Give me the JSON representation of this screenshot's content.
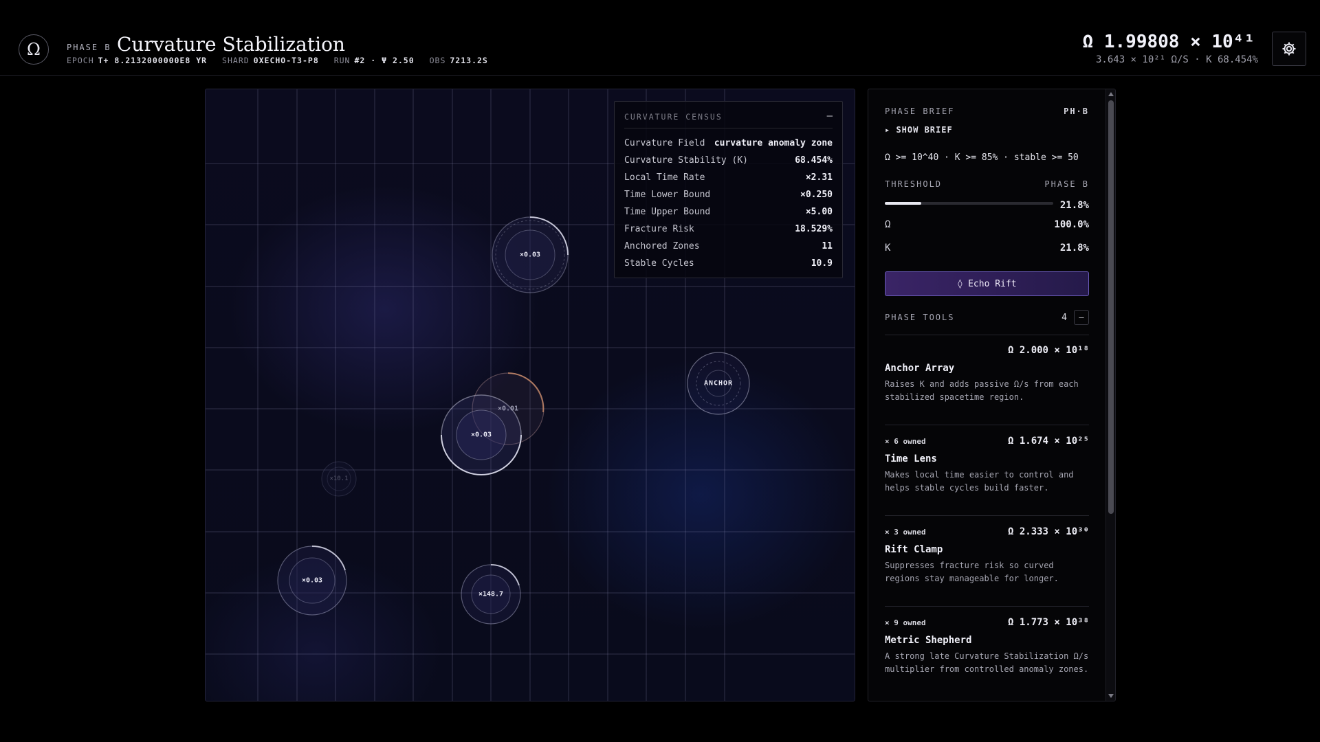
{
  "header": {
    "logo_glyph": "Ω",
    "phase_label": "PHASE B",
    "title": "Curvature Stabilization",
    "epoch_label": "EPOCH",
    "epoch_value": "T+ 8.2132000000E8 YR",
    "shard_label": "SHARD",
    "shard_value": "0XECHO-T3-P8",
    "run_label": "RUN",
    "run_value": "#2 · Ψ 2.50",
    "obs_label": "OBS",
    "obs_value": "7213.2S",
    "omega_total": "Ω 1.99808 × 10⁴¹",
    "omega_rate": "3.643 × 10²¹ Ω/S · K 68.454%",
    "settings_icon": "gear-icon"
  },
  "map": {
    "nodes": [
      {
        "label": "×0.03",
        "bright": true
      },
      {
        "label": "ANCHOR",
        "bright": true
      },
      {
        "label": "×0.01",
        "bright": false
      },
      {
        "label": "×0.03",
        "bright": true
      },
      {
        "label": "×10.1",
        "bright": false
      },
      {
        "label": "×0.03",
        "bright": true
      },
      {
        "label": "×148.7",
        "bright": true
      }
    ]
  },
  "census": {
    "title": "CURVATURE CENSUS",
    "collapse": "–",
    "rows": [
      {
        "k": "Curvature Field",
        "v": "curvature anomaly zone"
      },
      {
        "k": "Curvature Stability (K)",
        "v": "68.454%"
      },
      {
        "k": "Local Time Rate",
        "v": "×2.31"
      },
      {
        "k": "Time Lower Bound",
        "v": "×0.250"
      },
      {
        "k": "Time Upper Bound",
        "v": "×5.00"
      },
      {
        "k": "Fracture Risk",
        "v": "18.529%"
      },
      {
        "k": "Anchored Zones",
        "v": "11"
      },
      {
        "k": "Stable Cycles",
        "v": "10.9"
      }
    ]
  },
  "side": {
    "brief_label": "PHASE BRIEF",
    "brief_tag": "PH·B",
    "show_brief": "▸ SHOW BRIEF",
    "goal": "Ω >= 10^40 · K >= 85% · stable >= 50",
    "threshold_label": "THRESHOLD",
    "threshold_phase": "PHASE B",
    "threshold_pct": "21.8%",
    "threshold_fraction": 0.218,
    "omega_label": "Ω",
    "omega_pct": "100.0%",
    "k_label": "K",
    "k_pct": "21.8%",
    "echo_button": "◊ Echo Rift",
    "tools_label": "PHASE TOOLS",
    "tools_count": "4",
    "tools_toggle": "–",
    "tools": [
      {
        "owned": "",
        "cost": "Ω 2.000 × 10¹⁸",
        "name": "Anchor Array",
        "desc": "Raises K and adds passive Ω/s from each stabilized spacetime region."
      },
      {
        "owned": "× 6 owned",
        "cost": "Ω 1.674 × 10²⁵",
        "name": "Time Lens",
        "desc": "Makes local time easier to control and helps stable cycles build faster."
      },
      {
        "owned": "× 3 owned",
        "cost": "Ω 2.333 × 10³⁰",
        "name": "Rift Clamp",
        "desc": "Suppresses fracture risk so curved regions stay manageable for longer."
      },
      {
        "owned": "× 9 owned",
        "cost": "Ω 1.773 × 10³⁸",
        "name": "Metric Shepherd",
        "desc": "A strong late Curvature Stabilization Ω/s multiplier from controlled anomaly zones."
      }
    ]
  },
  "colors": {
    "accent": "#3a2466",
    "accent_border": "#6a5ab8",
    "background": "#000000",
    "map_bg": "#0b0b1e"
  }
}
